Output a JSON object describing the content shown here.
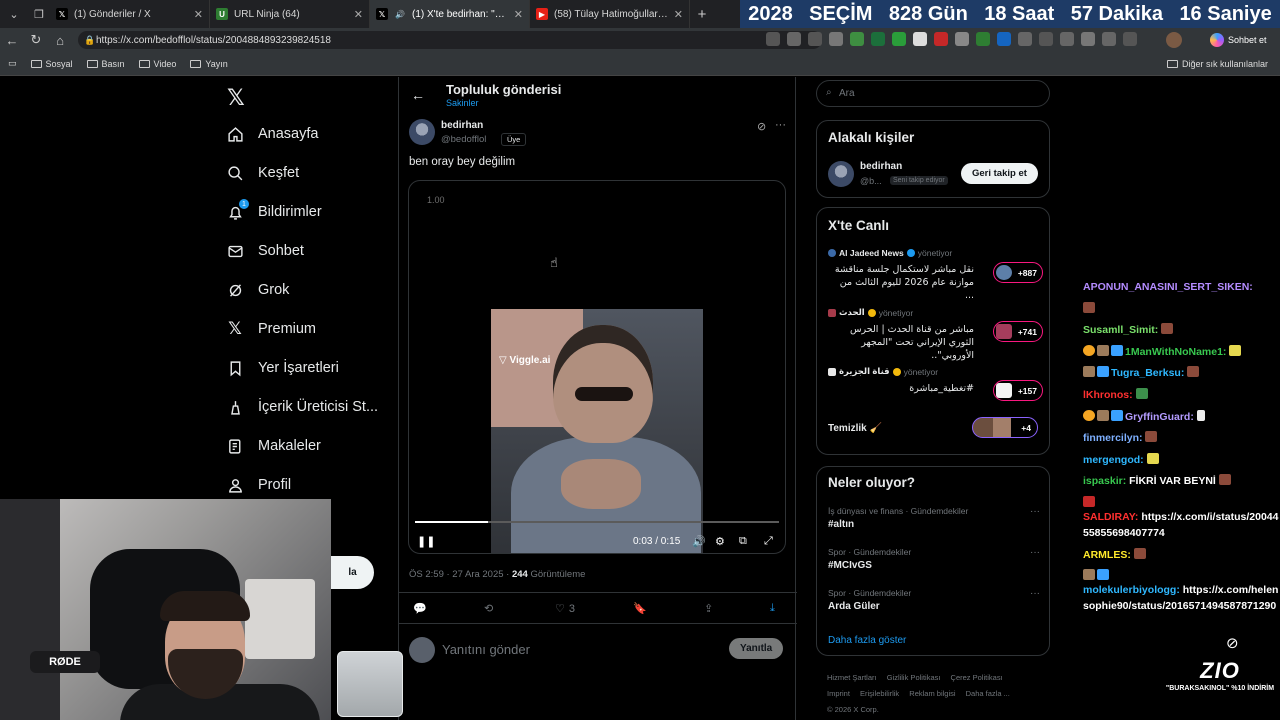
{
  "browser": {
    "tabs": [
      {
        "title": "(1) Gönderiler / X",
        "favicon": "x-icon",
        "active": false
      },
      {
        "title": "URL Ninja (64)",
        "favicon": "url-ninja-icon",
        "active": false
      },
      {
        "title": "(1) X'te bedirhan: \"ben oray be",
        "favicon": "x-icon",
        "active": true
      },
      {
        "title": "(58) Tülay Hatimoğulları ve Tuncer",
        "favicon": "youtube-icon",
        "active": false
      }
    ],
    "url": "https://x.com/bedofflol/status/2004884893239824518",
    "bookmarks": [
      "Sosyal",
      "Basın",
      "Video",
      "Yayın"
    ],
    "other_bookmarks": "Diğer sık kullanılanlar",
    "copilot_label": "Sohbet et"
  },
  "banner": {
    "year": "2028",
    "label": "SEÇİM",
    "days": "828 Gün",
    "hours": "18 Saat",
    "minutes": "57 Dakika",
    "seconds": "16 Saniye"
  },
  "nav": {
    "items": [
      {
        "label": "Anasayfa",
        "icon": "home-icon"
      },
      {
        "label": "Keşfet",
        "icon": "search-icon"
      },
      {
        "label": "Bildirimler",
        "icon": "bell-icon",
        "badge": "1"
      },
      {
        "label": "Sohbet",
        "icon": "mail-icon"
      },
      {
        "label": "Grok",
        "icon": "grok-icon"
      },
      {
        "label": "Premium",
        "icon": "x-icon"
      },
      {
        "label": "Yer İşaretleri",
        "icon": "bookmark-icon"
      },
      {
        "label": "İçerik Üreticisi St...",
        "icon": "creator-icon"
      },
      {
        "label": "Makaleler",
        "icon": "article-icon"
      },
      {
        "label": "Profil",
        "icon": "profile-icon"
      }
    ],
    "post_button_partial": "la"
  },
  "post": {
    "page_title": "Topluluk gönderisi",
    "page_subtitle": "Sakinler",
    "author_name": "bedirhan",
    "author_handle": "@bedofflol",
    "member_tag": "Üye",
    "text": "ben oray bey değilim",
    "video": {
      "speed": "1.00",
      "watermark": "Viggle.ai",
      "time": "0:03 / 0:15",
      "progress_fraction": 0.2
    },
    "timestamp": "ÖS 2:59 · 27 Ara 2025 · ",
    "views_count": "244",
    "views_label": " Görüntüleme",
    "likes": "3",
    "reply_placeholder": "Yanıtını gönder",
    "reply_button": "Yanıtla"
  },
  "sidebar": {
    "search_placeholder": "Ara",
    "related": {
      "title": "Alakalı kişiler",
      "name": "bedirhan",
      "handle": "@b...",
      "tag": "Seni takip ediyor",
      "button": "Geri takip et"
    },
    "live": {
      "title": "X'te Canlı",
      "items": [
        {
          "source": "Al Jadeed News",
          "role": "yönetiyor",
          "text": "نقل مباشر لاستكمال جلسة مناقشة موازنة عام 2026 لليوم الثالث من ...",
          "count": "+887"
        },
        {
          "source": "الحدث",
          "role": "yönetiyor",
          "text": "مباشر من قناة الحدث | الحرس الثوري الإيراني تحت \"المجهر الأوروبي\"..",
          "count": "+741"
        },
        {
          "source": "قناة الجزيرة",
          "role": "yönetiyor",
          "text": "#تغطية_مباشرة",
          "count": "+157"
        }
      ],
      "extra_title": "Temizlik 🧹",
      "extra_count": "+4"
    },
    "trends": {
      "title": "Neler oluyor?",
      "items": [
        {
          "category": "İş dünyası ve finans · Gündemdekiler",
          "name": "#altın"
        },
        {
          "category": "Spor · Gündemdekiler",
          "name": "#MCIvGS"
        },
        {
          "category": "Spor · Gündemdekiler",
          "name": "Arda Güler"
        }
      ],
      "show_more": "Daha fazla göster"
    },
    "footer": [
      "Hizmet Şartları",
      "Gizlilik Politikası",
      "Çerez Politikası",
      "Imprint",
      "Erişilebilirlik",
      "Reklam bilgisi",
      "Daha fazla ...",
      "© 2026 X Corp."
    ]
  },
  "chat": {
    "messages": [
      {
        "user": "APONUN_ANASINI_SERT_SIKEN:",
        "color": "#b48cff",
        "text": ""
      },
      {
        "user": "Susamll_Simit:",
        "color": "#7ae06b",
        "text": ""
      },
      {
        "user": "1ManWithNoName1:",
        "color": "#38c84f",
        "text": ""
      },
      {
        "user": "Tugra_Berksu:",
        "color": "#2fb8ff",
        "text": ""
      },
      {
        "user": "lKhronos:",
        "color": "#ff3030",
        "text": ""
      },
      {
        "user": "GryffinGuard:",
        "color": "#b49cff",
        "text": ""
      },
      {
        "user": "finmercilyn:",
        "color": "#7eb0ff",
        "text": ""
      },
      {
        "user": "mergengod:",
        "color": "#2fb8ff",
        "text": ""
      },
      {
        "user": "ispaskir:",
        "color": "#38c84f",
        "text": "FİKRİ VAR BEYNİ"
      },
      {
        "user": "SALDIRAY:",
        "color": "#ff3030",
        "text": "https://x.com/i/status/2004455855698407774"
      },
      {
        "user": "ARMLES:",
        "color": "#ffea2b",
        "text": ""
      },
      {
        "user": "molekulerbiyologg:",
        "color": "#2fb8ff",
        "text": "https://x.com/helensophie90/status/2016571494587871290"
      }
    ]
  },
  "overlay": {
    "mic_brand": "RØDE",
    "sponsor_logo": "ZIO",
    "sponsor_text": "\"BURAKSAKINOL\" %10 İNDİRİM"
  }
}
